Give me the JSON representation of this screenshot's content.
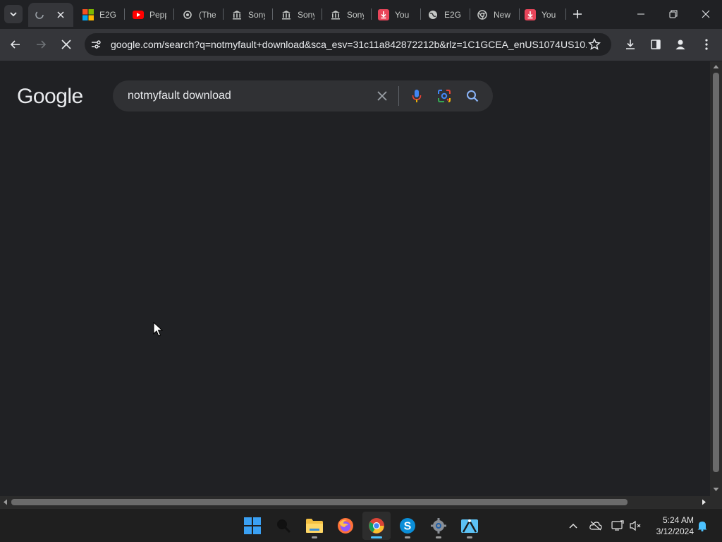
{
  "browser": {
    "tabs": [
      {
        "title": "",
        "icon": "loading-icon",
        "active": true
      },
      {
        "title": "E2G",
        "icon": "microsoft-icon"
      },
      {
        "title": "Pepp",
        "icon": "youtube-icon"
      },
      {
        "title": "(The",
        "icon": "thread-icon"
      },
      {
        "title": "Sony",
        "icon": "museum-icon"
      },
      {
        "title": "Sony",
        "icon": "museum-icon"
      },
      {
        "title": "Sony",
        "icon": "museum-icon"
      },
      {
        "title": "You",
        "icon": "download-icon"
      },
      {
        "title": "E2G",
        "icon": "globe-icon"
      },
      {
        "title": "New",
        "icon": "chrome-icon"
      },
      {
        "title": "You",
        "icon": "download-icon"
      }
    ],
    "url": "google.com/search?q=notmyfault+download&sca_esv=31c11a842872212b&rlz=1C1GCEA_enUS1074US10..."
  },
  "page": {
    "logo": "Google",
    "query": "notmyfault download"
  },
  "taskbar": {
    "apps": [
      "windows-start",
      "search",
      "file-explorer",
      "firefox",
      "chrome",
      "skype",
      "settings",
      "snipping-tool"
    ],
    "active_app": "chrome",
    "time": "5:24 AM",
    "date": "3/12/2024"
  },
  "colors": {
    "background": "#202124",
    "toolbar": "#35363a",
    "searchbox": "#303134",
    "accent": "#4cc2ff"
  }
}
